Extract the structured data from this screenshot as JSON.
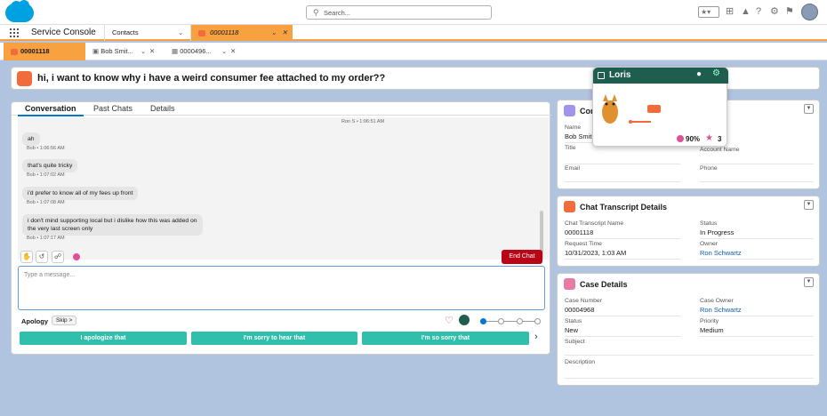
{
  "header": {
    "search_placeholder": "Search...",
    "icons": [
      "favorites-star-icon",
      "add-icon",
      "trailhead-icon",
      "help-icon",
      "setup-gear-icon",
      "notifications-bell-icon",
      "user-avatar"
    ]
  },
  "nav": {
    "app_name": "Service Console",
    "tabs": [
      {
        "label": "Contacts"
      },
      {
        "label": "00001118"
      }
    ]
  },
  "subtabs": [
    {
      "label": "00001118"
    },
    {
      "label": "Bob Smit..."
    },
    {
      "label": "0000496..."
    }
  ],
  "banner": {
    "text": "hi, i want to know why i have a weird consumer fee attached to my order??"
  },
  "conversation": {
    "tabs": [
      "Conversation",
      "Past Chats",
      "Details"
    ],
    "top_meta": "Ron S • 1:06:51 AM",
    "messages": [
      {
        "text": "ah",
        "meta": "Bob • 1:06:56 AM"
      },
      {
        "text": "that's quite tricky",
        "meta": "Bob • 1:07:02 AM"
      },
      {
        "text": "i'd prefer to know all of my fees up front",
        "meta": "Bob • 1:07:08 AM"
      },
      {
        "text": "i don't mind supporting local but i dislike how this was added on",
        "text2": "the very last screen only",
        "meta": "Bob • 1:07:17 AM"
      }
    ],
    "end_chat": "End Chat",
    "input_placeholder": "Type a message...",
    "apology_label": "Apology",
    "skip_label": "Skip >",
    "suggestions": [
      "I apologize that",
      "I'm sorry to hear that",
      "I'm so sorry that"
    ]
  },
  "contact": {
    "title": "Con",
    "name_label": "Name",
    "name_value": "Bob Smit",
    "title_label": "Title",
    "account_label": "Account Name",
    "email_label": "Email",
    "phone_label": "Phone"
  },
  "transcript": {
    "title": "Chat Transcript Details",
    "name_label": "Chat Transcript Name",
    "name_value": "00001118",
    "status_label": "Status",
    "status_value": "In Progress",
    "request_label": "Request Time",
    "request_value": "10/31/2023, 1:03 AM",
    "owner_label": "Owner",
    "owner_value": "Ron Schwartz"
  },
  "case": {
    "title": "Case Details",
    "number_label": "Case Number",
    "number_value": "00004968",
    "owner_label": "Case Owner",
    "owner_value": "Ron Schwartz",
    "status_label": "Status",
    "status_value": "New",
    "priority_label": "Priority",
    "priority_value": "Medium",
    "subject_label": "Subject",
    "description_label": "Description"
  },
  "loris": {
    "name": "Loris",
    "score": "90%",
    "stars": "3"
  },
  "colors": {
    "accent_orange": "#f7a141",
    "suggestion_teal": "#2fbfab",
    "end_chat_red": "#ba0517",
    "link_blue": "#0b5cab"
  }
}
